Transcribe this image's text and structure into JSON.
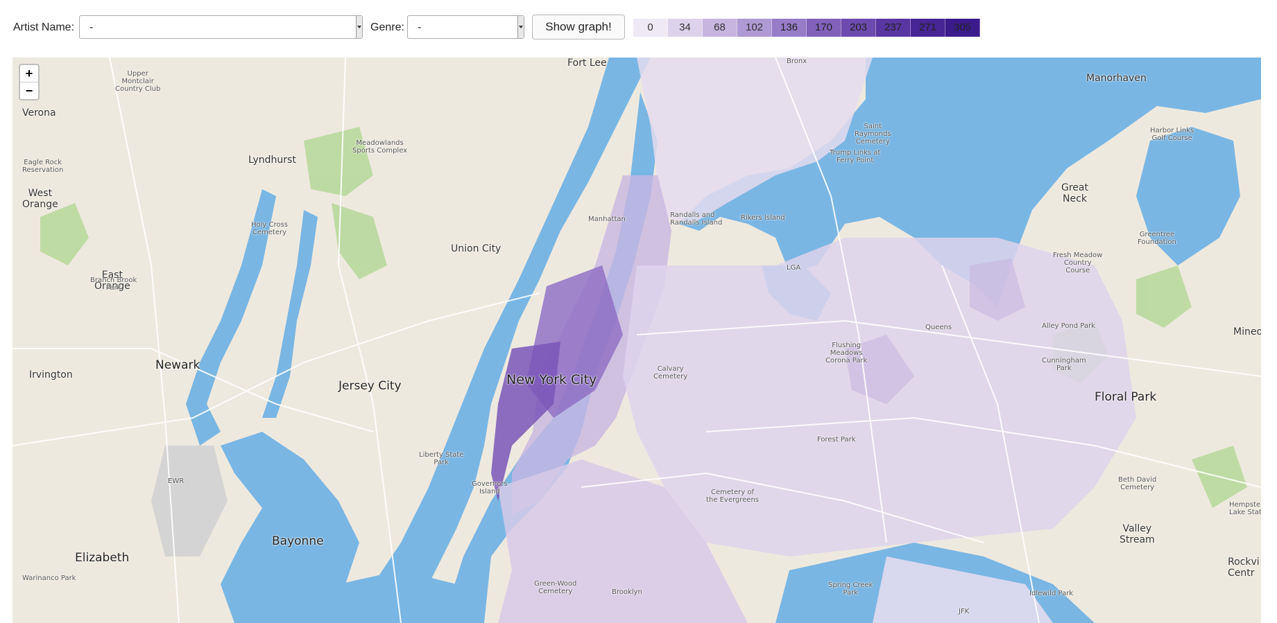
{
  "controls": {
    "artist_label": "Artist Name:",
    "artist_value": "-",
    "genre_label": "Genre:",
    "genre_value": "-",
    "show_button": "Show graph!"
  },
  "legend": [
    {
      "value": "0",
      "color": "#efe9f6",
      "text_color": "#333"
    },
    {
      "value": "34",
      "color": "#ddd2ec",
      "text_color": "#333"
    },
    {
      "value": "68",
      "color": "#c7b5e0",
      "text_color": "#333"
    },
    {
      "value": "102",
      "color": "#b09ad5",
      "text_color": "#333"
    },
    {
      "value": "136",
      "color": "#987cc8",
      "text_color": "#222"
    },
    {
      "value": "170",
      "color": "#8261bb",
      "text_color": "#222"
    },
    {
      "value": "203",
      "color": "#6d4aae",
      "text_color": "#222"
    },
    {
      "value": "237",
      "color": "#5a36a2",
      "text_color": "#222"
    },
    {
      "value": "271",
      "color": "#482595",
      "text_color": "#222"
    },
    {
      "value": "305",
      "color": "#3b1b8c",
      "text_color": "#222"
    }
  ],
  "map": {
    "zoom_in": "+",
    "zoom_out": "−",
    "places": {
      "verona": "Verona",
      "lyndhurst": "Lyndhurst",
      "west_orange": "West\nOrange",
      "east_orange": "East\nOrange",
      "newark": "Newark",
      "irvington": "Irvington",
      "elizabeth": "Elizabeth",
      "bayonne": "Bayonne",
      "jersey_city": "Jersey City",
      "union_city": "Union City",
      "fort_lee": "Fort Lee",
      "new_york_city": "New York City",
      "manhattan": "Manhattan",
      "randalls_island": "Randalls and\nRandalls Island",
      "rikers_island": "Rikers Island",
      "manorhaven": "Manorhaven",
      "great_neck": "Great\nNeck",
      "floral_park": "Floral Park",
      "valley_stream": "Valley\nStream",
      "queens": "Queens",
      "brooklyn": "Brooklyn",
      "mineola": "Mineo",
      "liberty_state_park": "Liberty State\nPark",
      "governors_island": "Governors\nIsland",
      "meadowlands": "Meadowlands\nSports Complex",
      "calvary": "Calvary\nCemetery",
      "flushing": "Flushing\nMeadows\nCorona Park",
      "forest_park": "Forest Park",
      "greentree": "Greentree\nFoundation",
      "harbor_links": "Harbor Links\nGolf Course",
      "rockville": "Rockvi\nCentr",
      "hempstead": "Hempste\nLake State",
      "branch_brook": "Branch Brook\nPark",
      "montclair": "Upper\nMontclair\nCountry Club",
      "eagle_rock": "Eagle Rock\nReservation",
      "holy_cross": "Holy Cross\nCemetery",
      "ewr": "EWR",
      "lga": "LGA",
      "jfk": "JFK",
      "bronx": "Bronx",
      "warinanco": "Warinanco Park",
      "fresh_meadow": "Fresh Meadow\nCountry\nCourse",
      "cunningham": "Cunningham\nPark",
      "alley_pond": "Alley Pond Park",
      "bethdavid": "Beth David\nCemetery",
      "idlewild": "Idlewild Park",
      "spring_creek": "Spring Creek\nPark",
      "evergreens": "Cemetery of\nthe Evergreens",
      "greenwood": "Green-Wood\nCemetery",
      "trump_links": "Trump Links at\nFerry Point",
      "st_raymonds": "Saint\nRaymonds\nCemetery"
    }
  }
}
